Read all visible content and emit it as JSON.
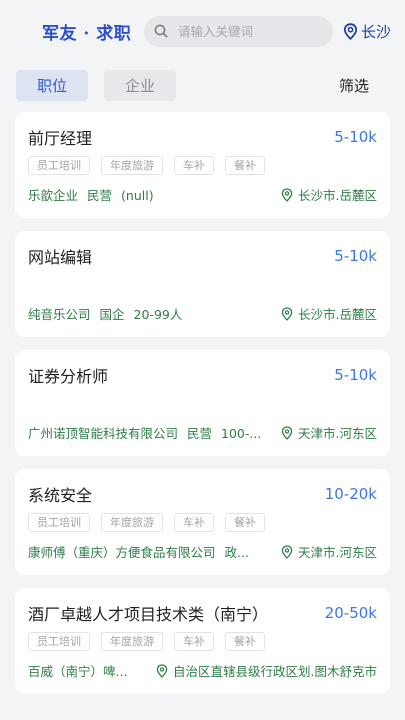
{
  "header": {
    "logo": "军友 · 求职",
    "search_placeholder": "请输入关键词",
    "city": "长沙"
  },
  "tabs": [
    {
      "label": "职位"
    },
    {
      "label": "企业"
    }
  ],
  "filter_label": "筛选",
  "colors": {
    "accent": "#2f5bd0",
    "salary": "#3d79dd",
    "company": "#2e7d46"
  },
  "jobs": [
    {
      "title": "前厅经理",
      "salary": "5-10k",
      "tags": [
        "员工培训",
        "年度旅游",
        "车补",
        "餐补"
      ],
      "company": "乐歆企业",
      "ownership": "民营",
      "size": "(null)",
      "location": "长沙市.岳麓区"
    },
    {
      "title": "网站编辑",
      "salary": "5-10k",
      "tags": [],
      "company": "纯音乐公司",
      "ownership": "国企",
      "size": "20-99人",
      "location": "长沙市.岳麓区"
    },
    {
      "title": "证券分析师",
      "salary": "5-10k",
      "tags": [],
      "company": "广州诺顶智能科技有限公司",
      "ownership": "民营",
      "size": "100-...",
      "location": "天津市.河东区"
    },
    {
      "title": "系统安全",
      "salary": "10-20k",
      "tags": [
        "员工培训",
        "年度旅游",
        "车补",
        "餐补"
      ],
      "company": "康师傅（重庆）方便食品有限公司",
      "ownership": "政...",
      "size": "",
      "location": "天津市.河东区"
    },
    {
      "title": "酒厂卓越人才项目技术类（南宁）",
      "salary": "20-50k",
      "tags": [
        "员工培训",
        "年度旅游",
        "车补",
        "餐补"
      ],
      "company": "百威（南宁）啤...",
      "ownership": "",
      "size": "",
      "location": "自治区直辖县级行政区划.图木舒克市"
    }
  ]
}
